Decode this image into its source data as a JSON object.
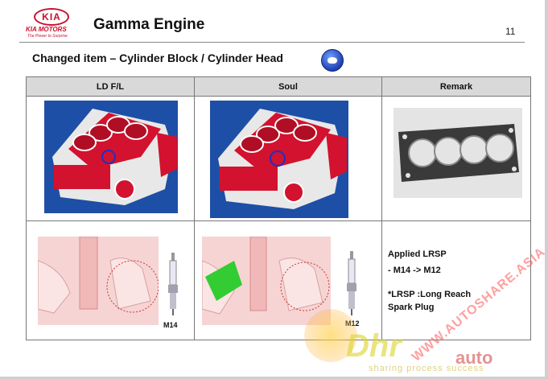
{
  "header": {
    "logo_text": "KIA",
    "brand": "KIA MOTORS",
    "tagline": "The Power to Surprise",
    "title": "Gamma Engine",
    "page_number": "11"
  },
  "subtitle": "Changed item – Cylinder Block / Cylinder Head",
  "table": {
    "columns": [
      "LD F/L",
      "Soul",
      "Remark"
    ],
    "plug_labels": {
      "ld": "M14",
      "soul": "M12"
    },
    "remark_lines": [
      "Applied  LRSP",
      " - M14 -> M12"
    ],
    "remark_lines_2": [
      "*LRSP :Long  Reach",
      "  Spark Plug"
    ]
  },
  "watermark": {
    "site": "WWW.AUTOSHARE.ASIA",
    "brand": "Dhr",
    "auto": "auto",
    "tagline": "sharing  process  success"
  },
  "colors": {
    "accent": "#c8102e",
    "header_bg": "#d9d9d9",
    "block_bg": "#1e4fa6"
  }
}
